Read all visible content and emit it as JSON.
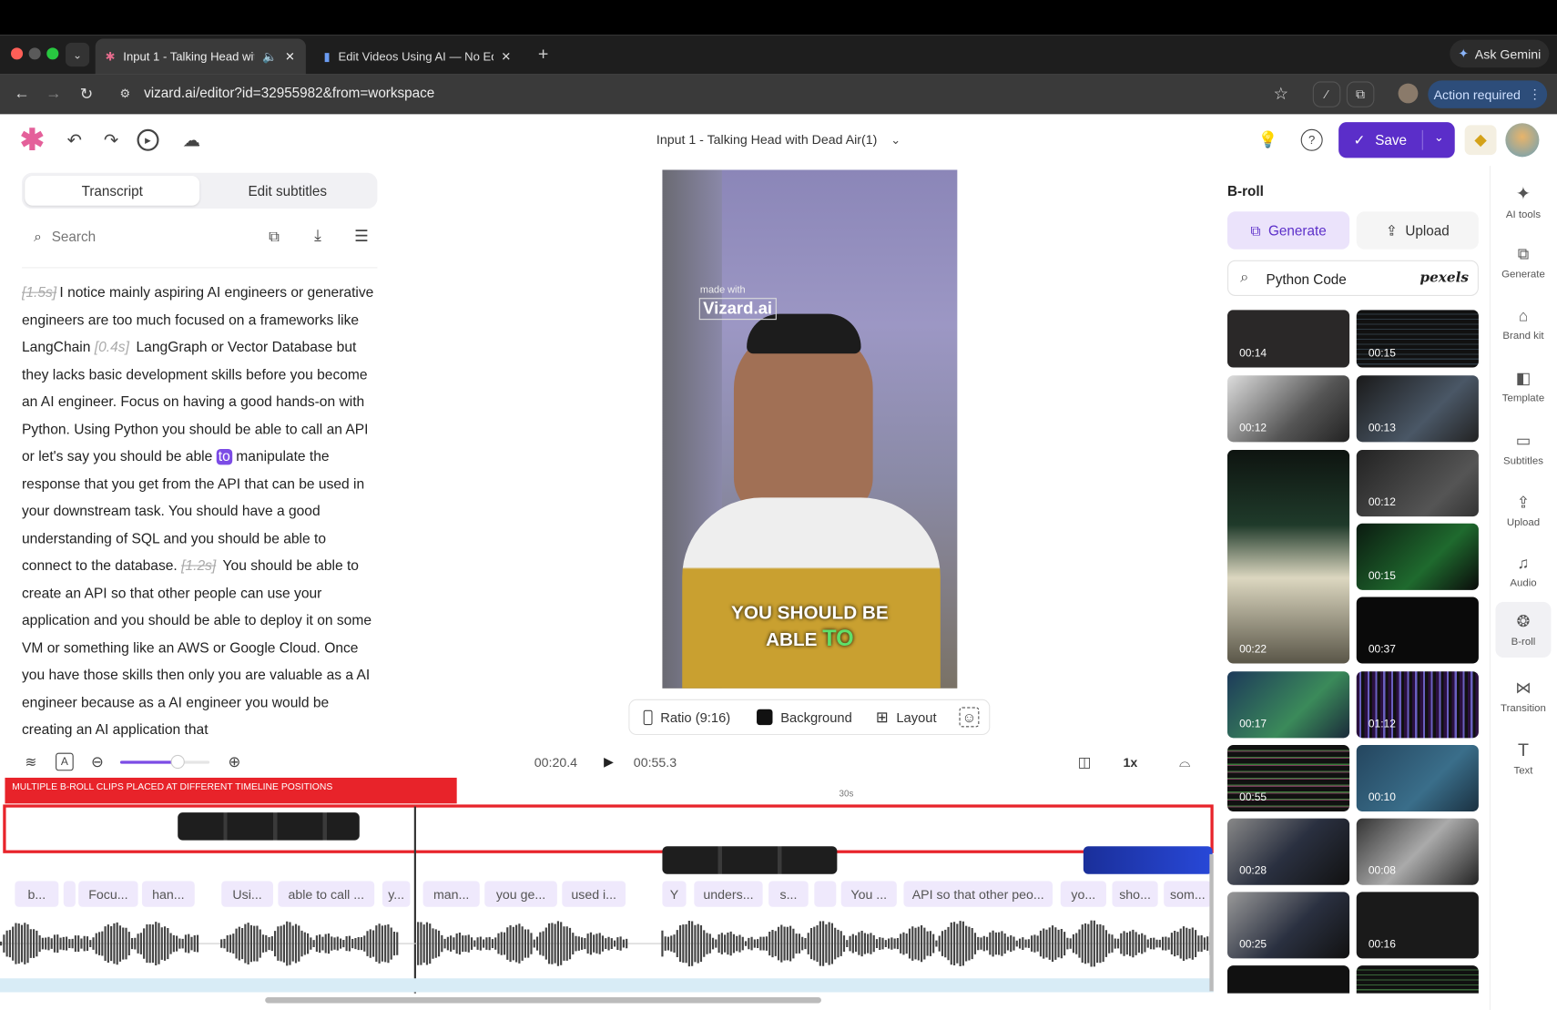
{
  "browser": {
    "tabs": [
      {
        "label": "Input 1 - Talking Head wit"
      },
      {
        "label": "Edit Videos Using AI — No Ed"
      }
    ],
    "new_tab": "+",
    "url": "vizard.ai/editor?id=32955982&from=workspace",
    "ask_gemini": "Ask Gemini",
    "action_required": "Action required"
  },
  "header": {
    "project_title": "Input 1 - Talking Head with Dead Air(1)",
    "save_label": "Save"
  },
  "left": {
    "tabs": [
      "Transcript",
      "Edit subtitles"
    ],
    "search_placeholder": "Search",
    "transcript": {
      "t1": "[1.5s]",
      "p1": "I notice mainly aspiring AI engineers or generative engineers are too much focused on a frameworks like LangChain ",
      "t2": "[0.4s]",
      "p2": " LangGraph or Vector Database but they lacks basic development skills before you become an AI engineer. Focus on having a good hands-on with Python. Using Python you should be able to call an API or let's say you should be able ",
      "hl": "to",
      "p3": " manipulate the response that you get from the API that can be used in your downstream task. You should have a good understanding of SQL and you should be able to connect to the database. ",
      "t3": "[1.2s]",
      "p4": " You should be able to create an API so that other people can use your application and you should be able to deploy it on some VM or something like an AWS or Google Cloud. Once you have those skills then only you are valuable as a AI engineer because as a AI engineer you would be creating an AI application that"
    }
  },
  "video": {
    "watermark_small": "made with",
    "watermark_big": "Vizard.ai",
    "caption_line1": "YOU SHOULD BE",
    "caption_line2a": "ABLE",
    "caption_line2b": "TO"
  },
  "video_toolbar": {
    "ratio": "Ratio (9:16)",
    "background": "Background",
    "layout": "Layout"
  },
  "playback": {
    "current": "00:20.4",
    "total": "00:55.3",
    "speed": "1x",
    "ruler_label": "30s",
    "zoom_level": 0.65
  },
  "annotation": "MULTIPLE B-ROLL CLIPS PLACED AT DIFFERENT TIMELINE POSITIONS",
  "timeline": {
    "subtitle_chips": [
      "b...",
      "Focu...",
      "han...",
      "Usi...",
      "able to call ...",
      "y...",
      "man...",
      "you ge...",
      "used i...",
      "Y",
      "unders...",
      "s...",
      "You ...",
      "API so that other peo...",
      "yo...",
      "sho...",
      "som..."
    ]
  },
  "broll": {
    "title": "B-roll",
    "generate": "Generate",
    "upload": "Upload",
    "search_value": "Python Code",
    "provider": "pexels",
    "thumbs": [
      "00:14",
      "00:15",
      "00:12",
      "00:13",
      "00:22",
      "00:12",
      "00:15",
      "00:37",
      "00:17",
      "01:12",
      "00:55",
      "00:10",
      "00:28",
      "00:08",
      "00:25",
      "00:16"
    ]
  },
  "sidebar": [
    "AI tools",
    "Generate",
    "Brand kit",
    "Template",
    "Subtitles",
    "Upload",
    "Audio",
    "B-roll",
    "Transition",
    "Text"
  ],
  "colors": {
    "accent": "#5b2ec9",
    "highlight": "#7c4ce6",
    "annotation_red": "#e8232a"
  }
}
